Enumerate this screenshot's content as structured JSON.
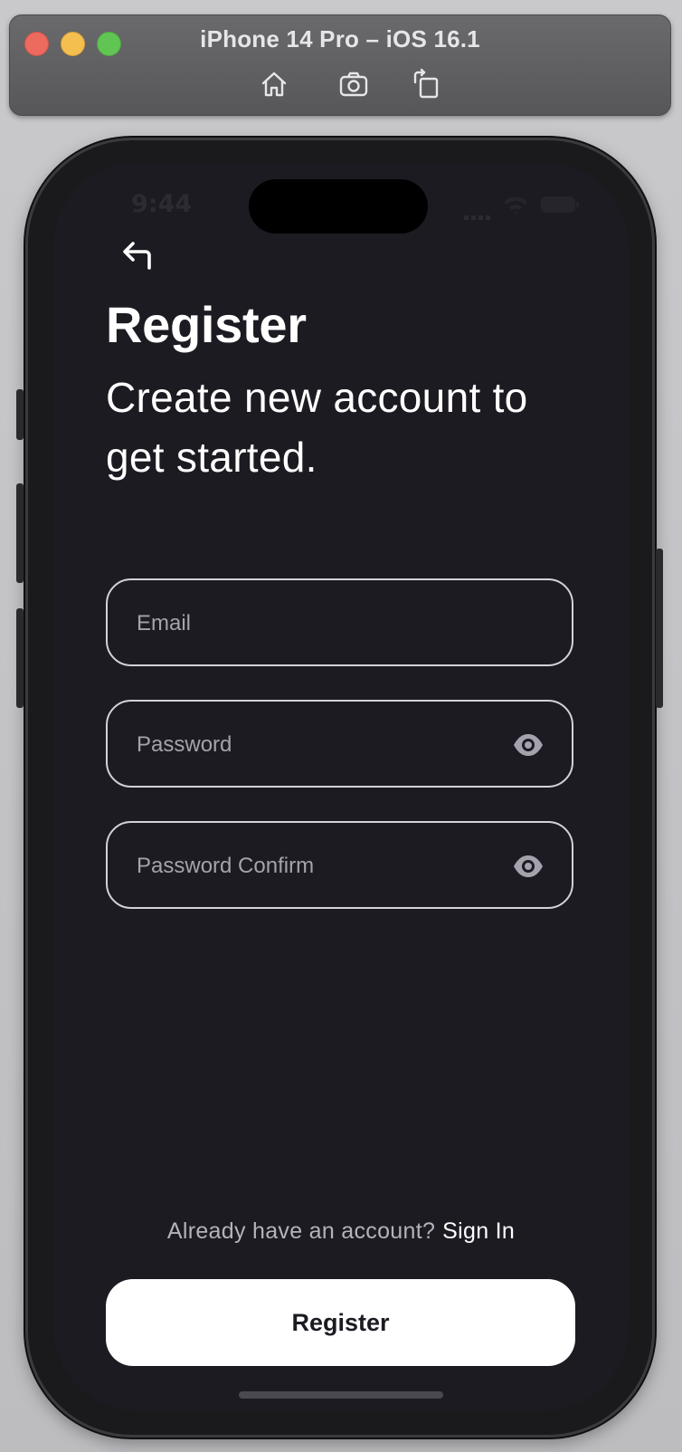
{
  "window": {
    "title": "iPhone 14 Pro – iOS 16.1",
    "toolbar_icons": [
      "home-icon",
      "screenshot-icon",
      "rotate-icon"
    ]
  },
  "status_bar": {
    "time": "9:44"
  },
  "screen": {
    "title": "Register",
    "subtitle": "Create new account to get started.",
    "form": {
      "email_placeholder": "Email",
      "password_placeholder": "Password",
      "password_confirm_placeholder": "Password Confirm"
    },
    "signin_prompt": "Already have an account?",
    "signin_link": "Sign In",
    "register_button": "Register"
  },
  "colors": {
    "background": "#1c1b22",
    "text": "#ffffff",
    "placeholder": "#a4a3ad",
    "field_border": "#d2d2d8",
    "button_bg": "#ffffff",
    "button_text": "#1c1b22"
  }
}
